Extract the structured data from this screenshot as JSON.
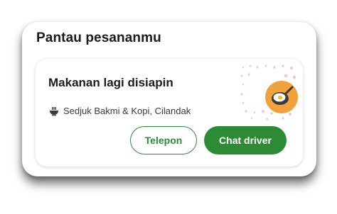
{
  "card": {
    "title": "Pantau pesananmu"
  },
  "order": {
    "status": "Makanan lagi disiapin",
    "merchant": "Sedjuk Bakmi & Kopi, Cilandak",
    "merchant_icon": "food-bowl-icon",
    "status_icon": "frying-pan-icon"
  },
  "actions": {
    "call_label": "Telepon",
    "chat_label": "Chat driver"
  },
  "colors": {
    "primary_green": "#2e8b35",
    "badge_orange": "#f2a23a",
    "dot_pink": "#f3c6cf"
  }
}
